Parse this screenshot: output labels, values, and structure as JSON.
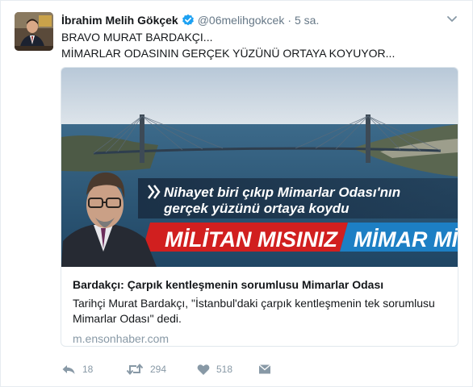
{
  "tweet": {
    "display_name": "İbrahim Melih Gökçek",
    "screen_name": "@06melihgokcek",
    "separator": "·",
    "timestamp": "5 sa.",
    "text_lines": [
      "BRAVO MURAT BARDAKÇI...",
      "MİMARLAR ODASININ GERÇEK YÜZÜNÜ ORTAYA KOYUYOR..."
    ]
  },
  "card": {
    "image": {
      "caption_line1": "Nihayet biri çıkıp Mimarlar Odası'nın",
      "caption_line2": "gerçek yüzünü ortaya koydu",
      "banner_left": "MİLİTAN MISINIZ",
      "banner_right": "MİMAR Mİ"
    },
    "title": "Bardakçı: Çarpık kentleşmenin sorumlusu Mimarlar Odası",
    "description": "Tarihçi Murat Bardakçı, \"İstanbul'daki çarpık kentleşmenin tek sorumlusu Mimarlar Odası\" dedi.",
    "domain": "m.ensonhaber.com"
  },
  "actions": {
    "reply_count": "18",
    "retweet_count": "294",
    "like_count": "518"
  },
  "icons": {
    "verified": "verified-badge-icon",
    "caret": "chevron-down-icon",
    "reply": "reply-icon",
    "retweet": "retweet-icon",
    "like": "heart-icon",
    "dm": "envelope-icon"
  },
  "colors": {
    "verified_blue": "#1da1f2",
    "muted": "#8899a6",
    "banner_red": "#d11f1f",
    "banner_blue": "#1d7fc4"
  }
}
